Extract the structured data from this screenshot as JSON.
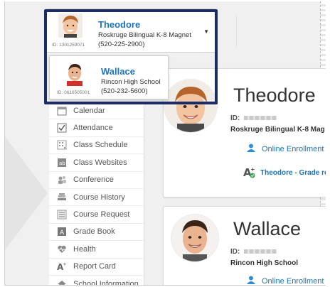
{
  "switcher": {
    "current": {
      "name": "Theodore",
      "school": "Roskruge Bilingual K-8 Magnet",
      "phone": "(520-225-2900)",
      "id_label": "ID: 1301259071"
    },
    "caret_icon": "caret-down-icon",
    "options": [
      {
        "name": "Wallace",
        "school": "Rincon High School",
        "phone": "(520-232-5600)",
        "id_label": "ID: 0616505001"
      }
    ]
  },
  "sidebar": {
    "items": [
      {
        "label": "Calendar",
        "icon": "calendar-icon"
      },
      {
        "label": "Attendance",
        "icon": "checkbox-icon"
      },
      {
        "label": "Class Schedule",
        "icon": "schedule-icon"
      },
      {
        "label": "Class Websites",
        "icon": "website-icon"
      },
      {
        "label": "Conference",
        "icon": "people-icon"
      },
      {
        "label": "Course History",
        "icon": "books-icon"
      },
      {
        "label": "Course Request",
        "icon": "list-icon"
      },
      {
        "label": "Grade Book",
        "icon": "gradebook-icon"
      },
      {
        "label": "Health",
        "icon": "heart-icon"
      },
      {
        "label": "Report Card",
        "icon": "report-card-icon"
      },
      {
        "label": "School Information",
        "icon": "school-icon"
      }
    ]
  },
  "cards": [
    {
      "name": "Theodore",
      "id_label": "ID:",
      "school": "Roskruge Bilingual K-8 Mag",
      "enrollment_link": "Online Enrollment is",
      "grade_link": "Theodore - Grade re"
    },
    {
      "name": "Wallace",
      "id_label": "ID:",
      "school": "Rincon High School",
      "enrollment_link": "Online Enrollment is"
    }
  ],
  "colors": {
    "highlight_border": "#1c2c66",
    "link": "#1b75bb",
    "name_link": "#1b75bb",
    "enrollment_icon": "#2f8fd6",
    "grade_icon_badge": "#3aa655"
  }
}
